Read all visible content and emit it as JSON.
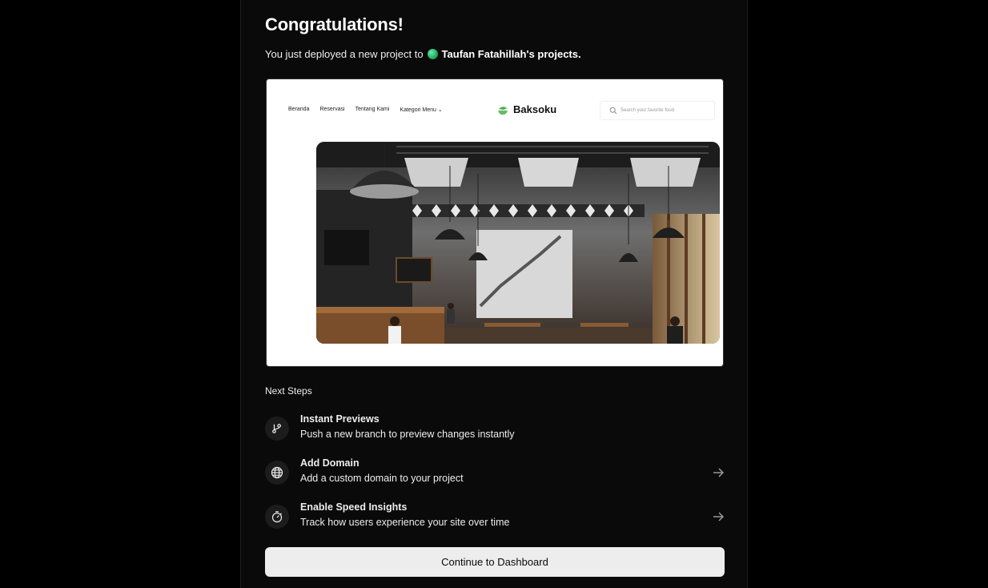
{
  "header": {
    "title": "Congratulations!",
    "subtitle_prefix": "You just deployed a new project to",
    "team_name": "Taufan Fatahillah's projects."
  },
  "preview": {
    "nav_items": [
      "Beranda",
      "Reservasi",
      "Tentang Kami",
      "Kategori Menu"
    ],
    "brand": "Baksoku",
    "search_placeholder": "Search your favorite food"
  },
  "next_steps": {
    "label": "Next Steps",
    "items": [
      {
        "title": "Instant Previews",
        "description": "Push a new branch to preview changes instantly",
        "icon": "git-branch-icon",
        "has_arrow": false
      },
      {
        "title": "Add Domain",
        "description": "Add a custom domain to your project",
        "icon": "globe-icon",
        "has_arrow": true
      },
      {
        "title": "Enable Speed Insights",
        "description": "Track how users experience your site over time",
        "icon": "stopwatch-icon",
        "has_arrow": true
      }
    ]
  },
  "cta": {
    "label": "Continue to Dashboard"
  },
  "colors": {
    "page_bg": "#000000",
    "panel_bg": "#0a0a0a",
    "button_bg": "#ededed",
    "team_dot": "#22c55e",
    "logo_green": "#4caf50"
  }
}
